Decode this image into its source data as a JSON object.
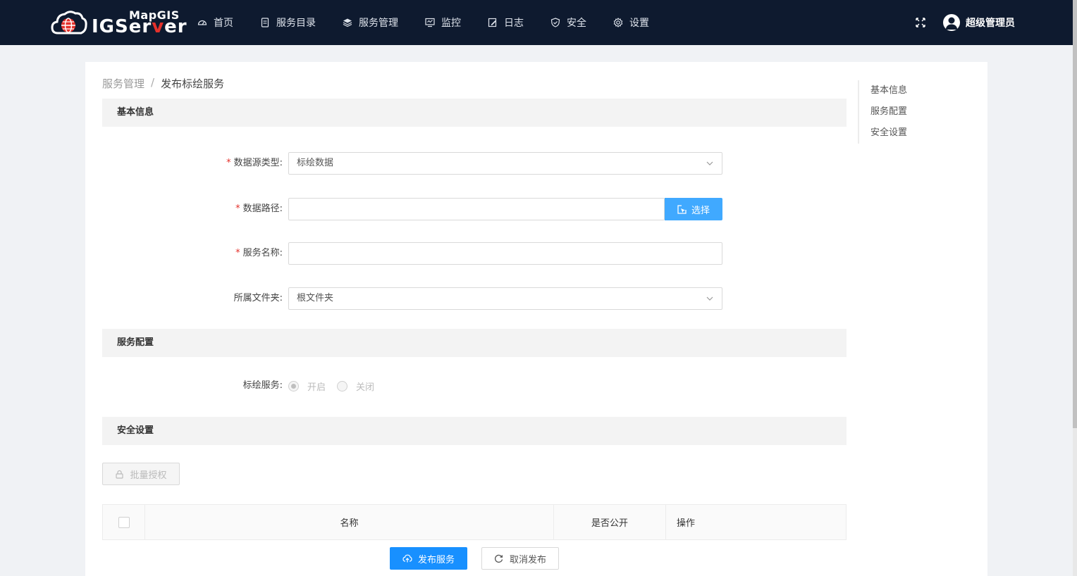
{
  "brand": {
    "small": "MapGIS",
    "big_prefix": "IGSer",
    "big_accent": "v",
    "big_suffix": "er",
    "accent_color": "#e4312b"
  },
  "nav": [
    {
      "label": "首页",
      "icon": "dashboard-icon"
    },
    {
      "label": "服务目录",
      "icon": "catalog-icon"
    },
    {
      "label": "服务管理",
      "icon": "layers-icon"
    },
    {
      "label": "监控",
      "icon": "monitor-icon"
    },
    {
      "label": "日志",
      "icon": "edit-log-icon"
    },
    {
      "label": "安全",
      "icon": "shield-icon"
    },
    {
      "label": "设置",
      "icon": "gear-icon"
    }
  ],
  "user": {
    "name": "超级管理员"
  },
  "breadcrumb": {
    "parent": "服务管理",
    "separator": "/",
    "current": "发布标绘服务"
  },
  "sections": {
    "basic": "基本信息",
    "config": "服务配置",
    "security": "安全设置"
  },
  "form": {
    "source_type": {
      "label": "数据源类型:",
      "value": "标绘数据"
    },
    "data_path": {
      "label": "数据路径:",
      "value": "",
      "button": "选择"
    },
    "service_name": {
      "label": "服务名称:",
      "value": ""
    },
    "folder": {
      "label": "所属文件夹:",
      "value": "根文件夹"
    }
  },
  "plot_service": {
    "label": "标绘服务:",
    "on": "开启",
    "off": "关闭",
    "selected": "开启"
  },
  "security": {
    "batch_button": "批量授权",
    "columns": [
      "名称",
      "是否公开",
      "操作"
    ]
  },
  "actions": {
    "publish": "发布服务",
    "cancel": "取消发布"
  },
  "anchor": [
    "基本信息",
    "服务配置",
    "安全设置"
  ],
  "colors": {
    "topbar": "#0e1a2f",
    "primary": "#1890ff",
    "select_button": "#40a9ff"
  }
}
